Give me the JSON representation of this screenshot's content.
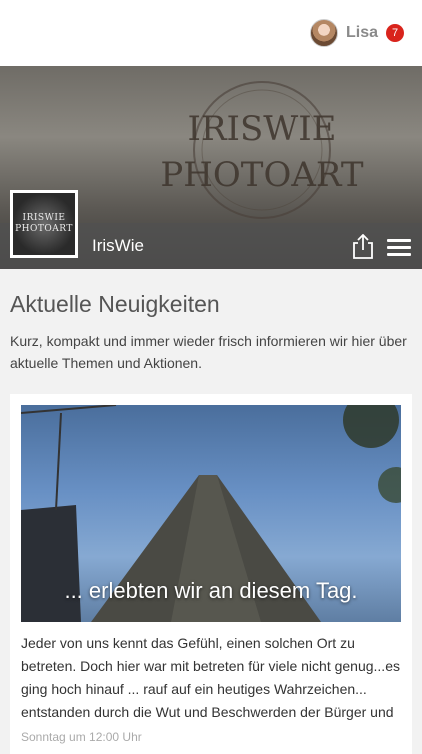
{
  "user": {
    "name": "Lisa",
    "notification_count": "7"
  },
  "hero": {
    "brand_line_1": "IRISWIE",
    "brand_line_2": "PHOTOART",
    "title": "IrisWie"
  },
  "logo": {
    "line_1": "IRISWIE",
    "line_2": "PHOTOART"
  },
  "section": {
    "title": "Aktuelle Neuigkeiten",
    "description": "Kurz, kompakt und immer wieder frisch informieren wir hier über aktuelle Themen und Aktionen."
  },
  "post": {
    "caption": "... erlebten wir an diesem Tag.",
    "text": "Jeder von uns kennt das Gefühl, einen solchen Ort zu betreten. Doch hier war mit betreten für viele nicht genug...es ging hoch hinauf ... rauf auf ein heutiges Wahrzeichen... entstanden durch die Wut und Beschwerden der Bürger und",
    "timestamp": "Sonntag um 12:00 Uhr"
  },
  "icons": {
    "share": "share-icon",
    "menu": "hamburger-menu-icon"
  }
}
